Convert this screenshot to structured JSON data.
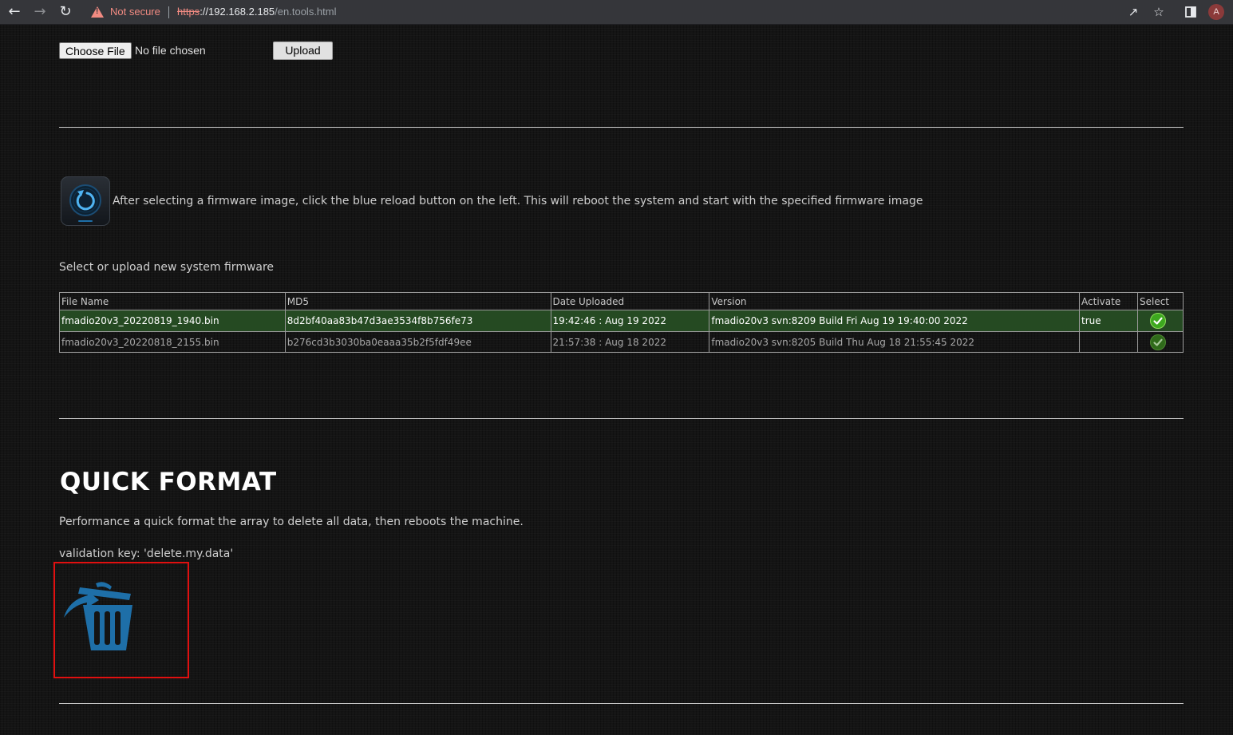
{
  "browser": {
    "security_label": "Not secure",
    "url_scheme": "https",
    "url_host": "://192.168.2.185",
    "url_path": "/en.tools.html",
    "profile_initial": "A"
  },
  "upload": {
    "choose_file_label": "Choose File",
    "file_status": "No file chosen",
    "upload_label": "Upload"
  },
  "firmware": {
    "reload_instruction": "After selecting a firmware image, click the blue reload button on the left. This will reboot the system and start with the specified firmware image",
    "select_label": "Select or upload new system firmware",
    "table": {
      "headers": [
        "File Name",
        "MD5",
        "Date Uploaded",
        "Version",
        "Activate",
        "Select"
      ],
      "rows": [
        {
          "file_name": "fmadio20v3_20220819_1940.bin",
          "md5": "8d2bf40aa83b47d3ae3534f8b756fe73",
          "date_uploaded": "19:42:46 : Aug 19 2022",
          "version": "fmadio20v3 svn:8209 Build Fri Aug 19 19:40:00 2022",
          "activate": "true",
          "select_icon": "check-circle-icon"
        },
        {
          "file_name": "fmadio20v3_20220818_2155.bin",
          "md5": "b276cd3b3030ba0eaaa35b2f5fdf49ee",
          "date_uploaded": "21:57:38 : Aug 18 2022",
          "version": "fmadio20v3 svn:8205 Build Thu Aug 18 21:55:45 2022",
          "activate": "",
          "select_icon": "check-circle-icon"
        }
      ]
    }
  },
  "quick_format": {
    "title": "QUICK FORMAT",
    "description": "Performance a quick format the array to delete all data, then reboots the machine.",
    "validation_key": "validation key: 'delete.my.data'",
    "trash_icon": "trash-icon"
  },
  "colors": {
    "active_row": "#254a22",
    "accent_blue": "#1e6fa8",
    "highlight": "#e01010",
    "check_green": "#3da81f"
  }
}
